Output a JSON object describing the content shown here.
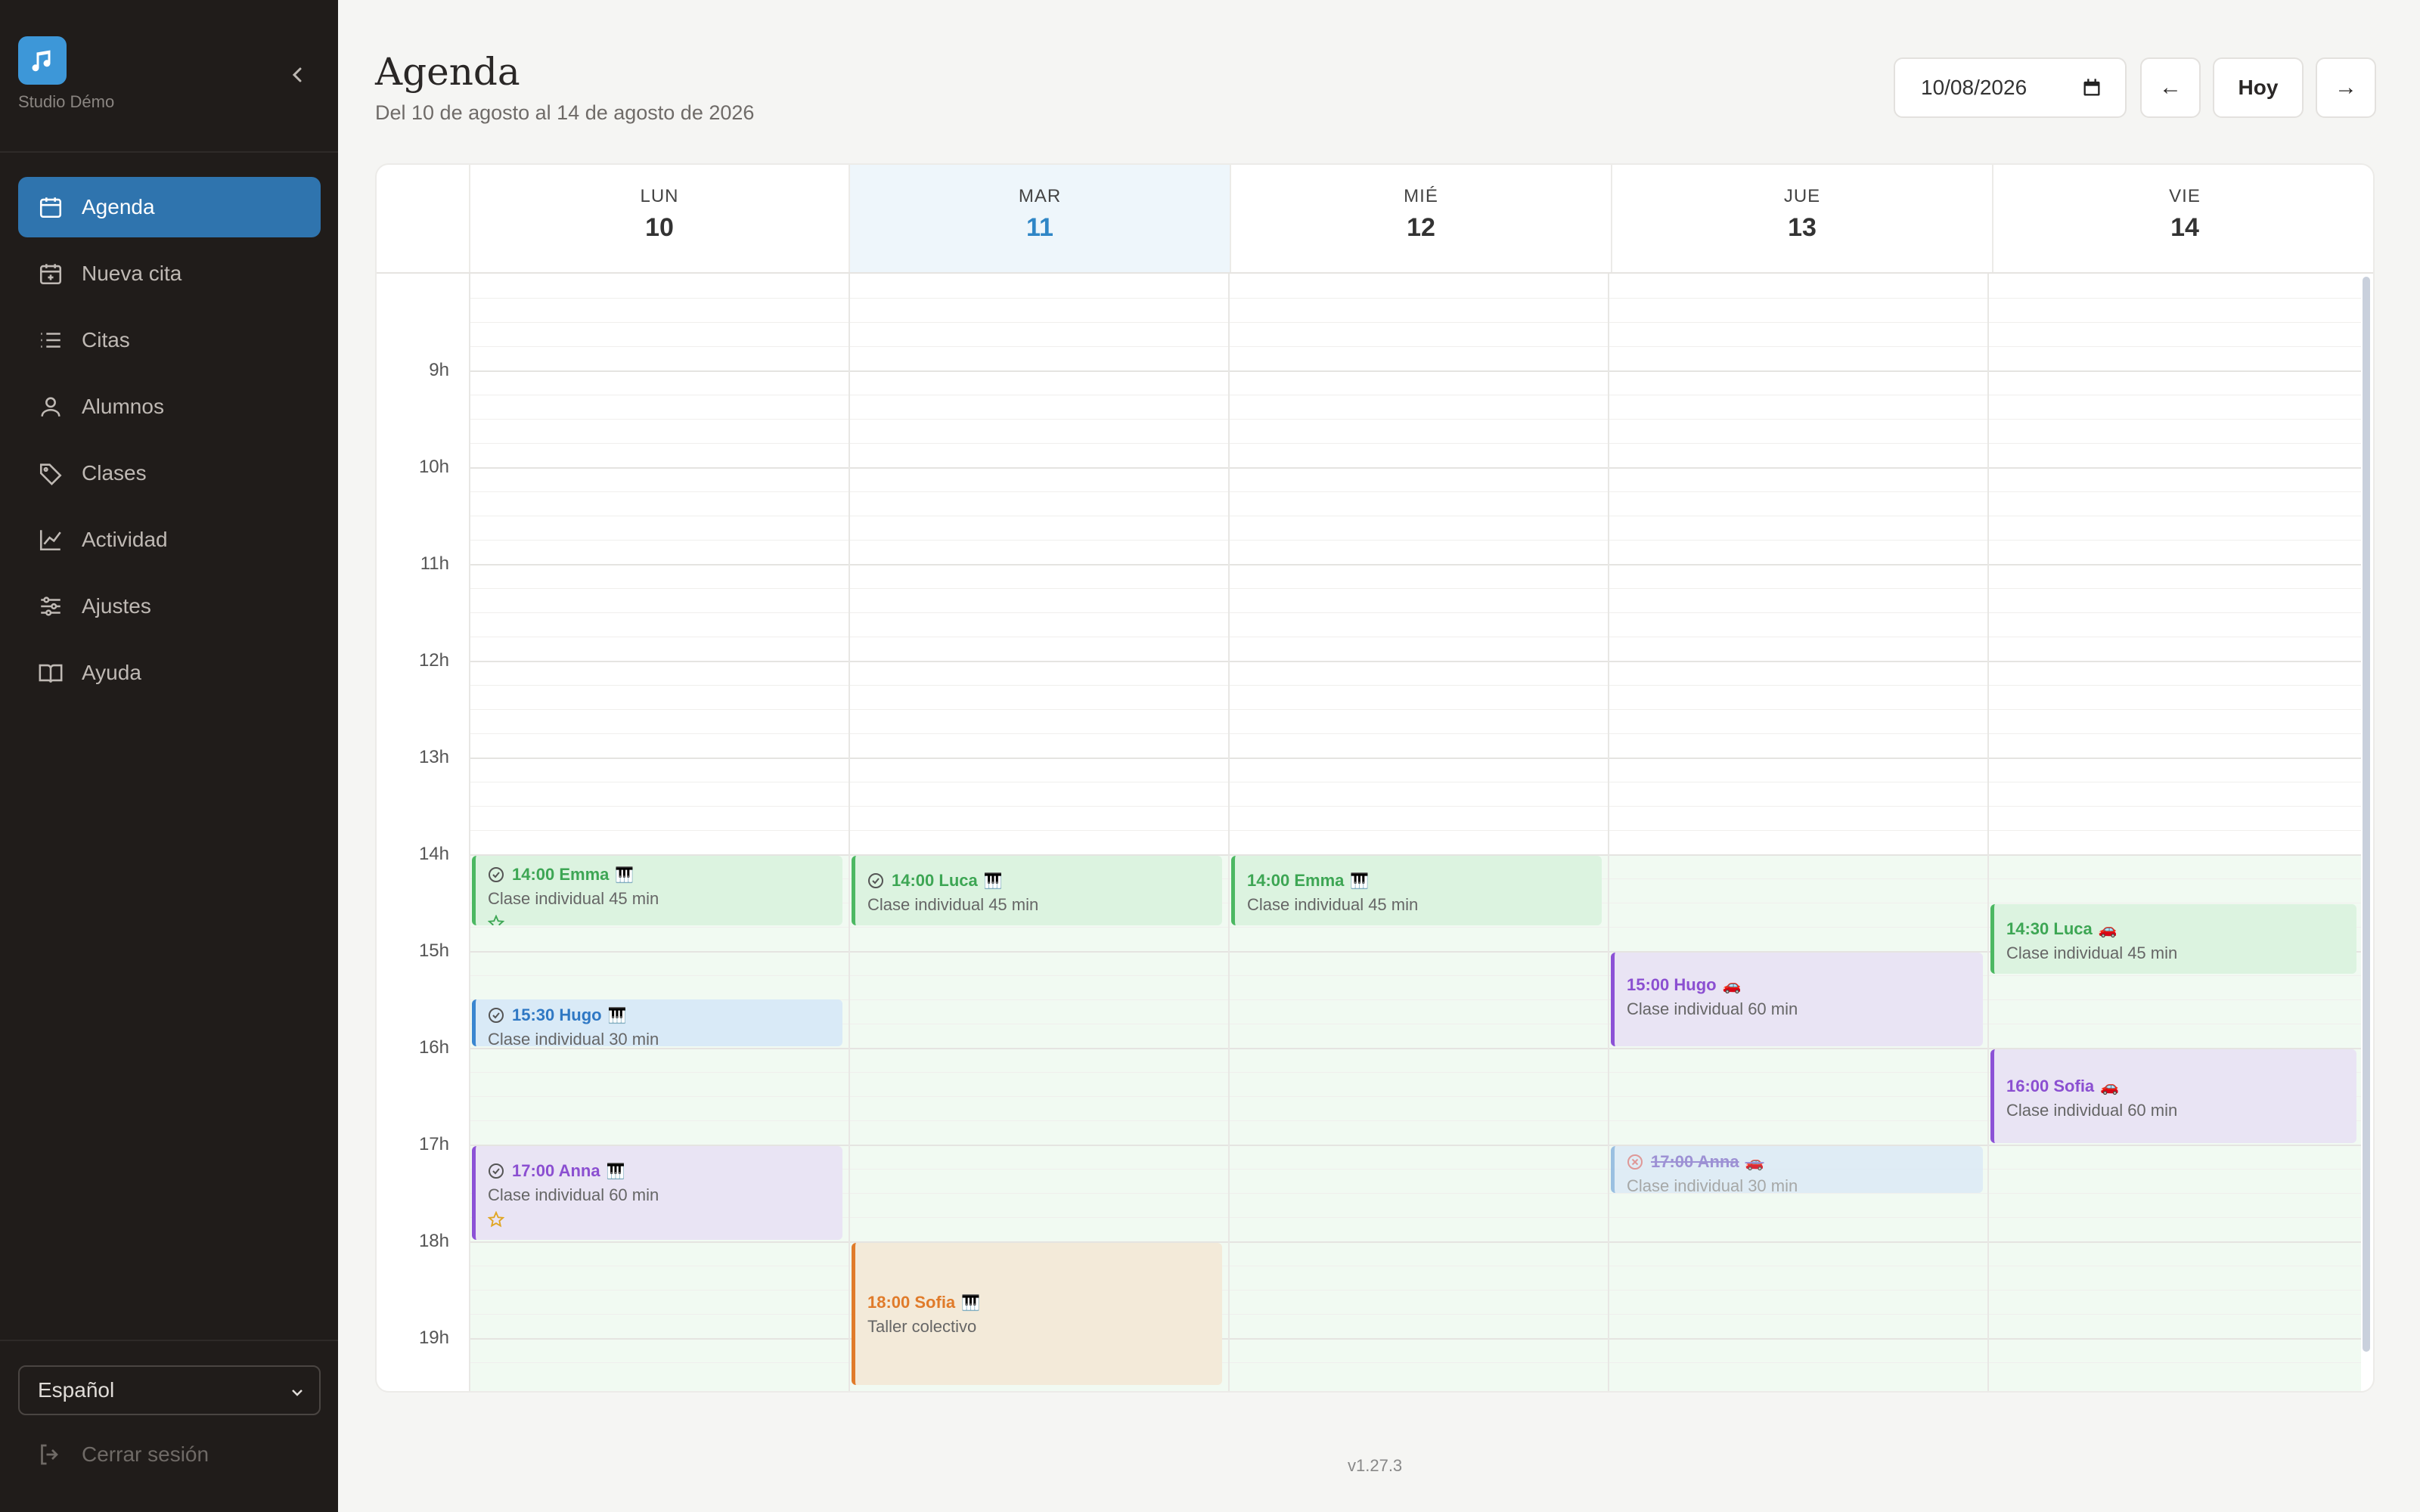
{
  "sidebar": {
    "studio_name": "Studio Démo",
    "nav": [
      {
        "label": "Agenda",
        "icon": "calendar-icon"
      },
      {
        "label": "Nueva cita",
        "icon": "calendar-plus-icon"
      },
      {
        "label": "Citas",
        "icon": "list-icon"
      },
      {
        "label": "Alumnos",
        "icon": "user-icon"
      },
      {
        "label": "Clases",
        "icon": "tag-icon"
      },
      {
        "label": "Actividad",
        "icon": "chart-line-icon"
      },
      {
        "label": "Ajustes",
        "icon": "sliders-icon"
      },
      {
        "label": "Ayuda",
        "icon": "book-icon"
      }
    ],
    "language": "Español",
    "logout": "Cerrar sesión"
  },
  "header": {
    "title": "Agenda",
    "subtitle": "Del 10 de agosto al 14 de agosto de 2026",
    "date_value": "10/08/2026",
    "prev_label": "←",
    "today_label": "Hoy",
    "next_label": "→"
  },
  "calendar": {
    "days": [
      {
        "name": "LUN",
        "num": "10"
      },
      {
        "name": "MAR",
        "num": "11",
        "today": true
      },
      {
        "name": "MIÉ",
        "num": "12"
      },
      {
        "name": "JUE",
        "num": "13"
      },
      {
        "name": "VIE",
        "num": "14"
      }
    ],
    "hours": [
      "9h",
      "10h",
      "11h",
      "12h",
      "13h",
      "14h",
      "15h",
      "16h",
      "17h",
      "18h",
      "19h"
    ],
    "events": [
      {
        "title": "14:00 Emma",
        "subtitle": "Clase individual 45 min"
      },
      {
        "title": "15:30 Hugo",
        "subtitle": "Clase individual 30 min"
      },
      {
        "title": "17:00 Anna",
        "subtitle": "Clase individual 60 min"
      },
      {
        "title": "14:00 Luca",
        "subtitle": "Clase individual 45 min"
      },
      {
        "title": "18:00 Sofia",
        "subtitle": "Taller colectivo"
      },
      {
        "title": "14:00 Emma",
        "subtitle": "Clase individual 45 min"
      },
      {
        "title": "15:00 Hugo",
        "subtitle": "Clase individual 60 min"
      },
      {
        "title": "17:00 Anna",
        "subtitle": "Clase individual 30 min",
        "status": "cancelled"
      },
      {
        "title": "14:30 Luca",
        "subtitle": "Clase individual 45 min"
      },
      {
        "title": "16:00 Sofia",
        "subtitle": "Clase individual 60 min"
      }
    ]
  },
  "footer": {
    "version": "v1.27.3"
  },
  "colors": {
    "accent": "#2f74ae",
    "green": "#4cb862",
    "blue": "#3a86d0",
    "purple": "#8c52d6",
    "orange": "#e07b2a"
  }
}
